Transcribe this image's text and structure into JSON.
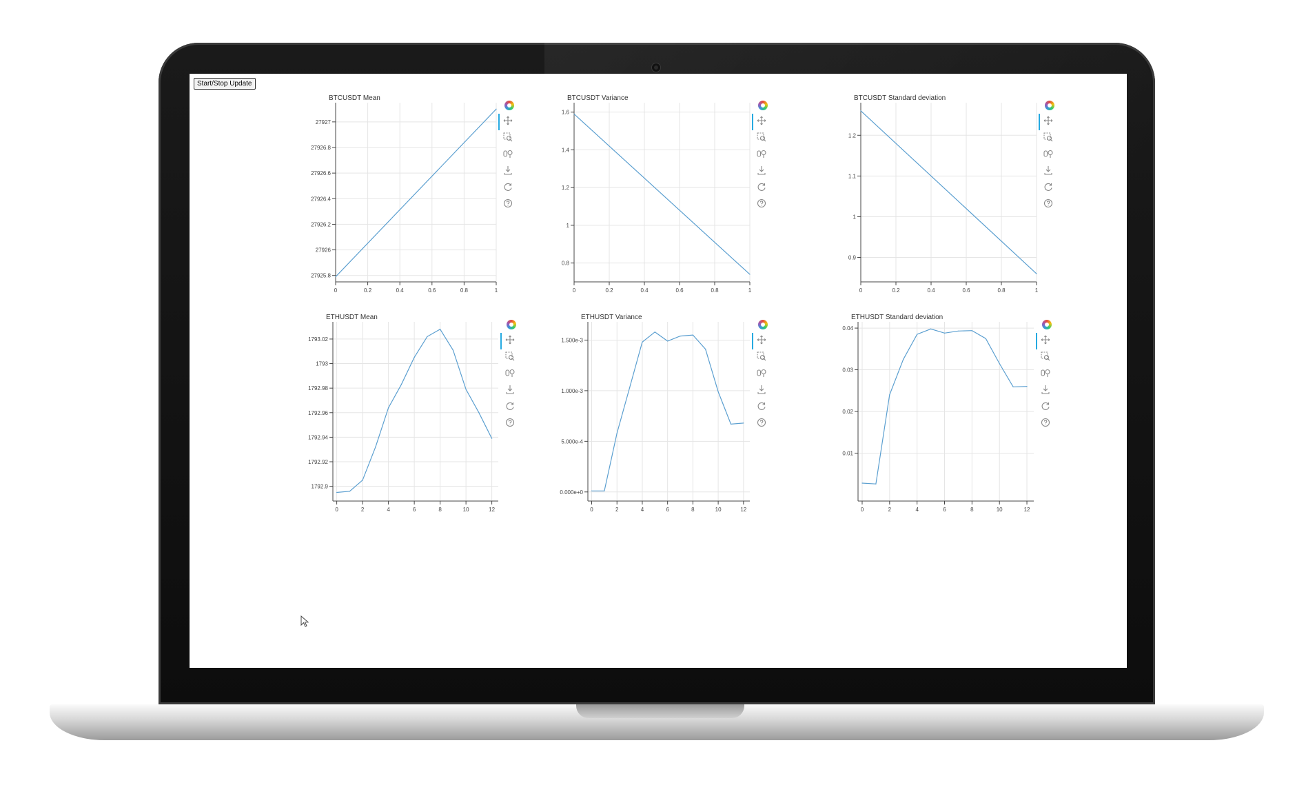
{
  "app": {
    "toggle_button": "Start/Stop Update"
  },
  "toolbar_icons": [
    "bokeh-logo-icon",
    "pan-icon",
    "box-zoom-icon",
    "wheel-zoom-icon",
    "save-icon",
    "reset-icon",
    "help-icon"
  ],
  "colors": {
    "line": "#5b9fd0",
    "grid": "#e5e5e5",
    "accent": "#26aae1"
  },
  "chart_data": [
    {
      "type": "line",
      "title": "BTCUSDT Mean",
      "x": [
        0,
        1
      ],
      "y": [
        27925.79,
        27927.1
      ],
      "xlim": [
        0,
        1
      ],
      "ylim": [
        27925.75,
        27927.15
      ],
      "xticks": [
        "0",
        "0.2",
        "0.4",
        "0.6",
        "0.8",
        "1"
      ],
      "xtick_values": [
        0,
        0.2,
        0.4,
        0.6,
        0.8,
        1
      ],
      "yticks": [
        "27925.8",
        "27926",
        "27926.2",
        "27926.4",
        "27926.6",
        "27926.8",
        "27927"
      ],
      "ytick_values": [
        27925.8,
        27926.0,
        27926.2,
        27926.4,
        27926.6,
        27926.8,
        27927.0
      ]
    },
    {
      "type": "line",
      "title": "BTCUSDT Variance",
      "x": [
        0,
        1
      ],
      "y": [
        1.59,
        0.74
      ],
      "xlim": [
        0,
        1
      ],
      "ylim": [
        0.7,
        1.65
      ],
      "xticks": [
        "0",
        "0.2",
        "0.4",
        "0.6",
        "0.8",
        "1"
      ],
      "xtick_values": [
        0,
        0.2,
        0.4,
        0.6,
        0.8,
        1
      ],
      "yticks": [
        "0.8",
        "1",
        "1.2",
        "1.4",
        "1.6"
      ],
      "ytick_values": [
        0.8,
        1.0,
        1.2,
        1.4,
        1.6
      ]
    },
    {
      "type": "line",
      "title": "BTCUSDT Standard deviation",
      "x": [
        0,
        1
      ],
      "y": [
        1.26,
        0.86
      ],
      "xlim": [
        0,
        1
      ],
      "ylim": [
        0.84,
        1.28
      ],
      "xticks": [
        "0",
        "0.2",
        "0.4",
        "0.6",
        "0.8",
        "1"
      ],
      "xtick_values": [
        0,
        0.2,
        0.4,
        0.6,
        0.8,
        1
      ],
      "yticks": [
        "0.9",
        "1",
        "1.1",
        "1.2"
      ],
      "ytick_values": [
        0.9,
        1.0,
        1.1,
        1.2
      ]
    },
    {
      "type": "line",
      "title": "ETHUSDT Mean",
      "x": [
        0,
        1,
        2,
        3,
        4,
        5,
        6,
        7,
        8,
        9,
        10,
        11,
        12
      ],
      "y": [
        1792.895,
        1792.896,
        1792.905,
        1792.932,
        1792.964,
        1792.983,
        1793.005,
        1793.022,
        1793.028,
        1793.011,
        1792.979,
        1792.96,
        1792.939
      ],
      "xlim": [
        -0.3,
        12.5
      ],
      "ylim": [
        1792.888,
        1793.034
      ],
      "xticks": [
        "0",
        "2",
        "4",
        "6",
        "8",
        "10",
        "12"
      ],
      "xtick_values": [
        0,
        2,
        4,
        6,
        8,
        10,
        12
      ],
      "yticks": [
        "1792.9",
        "1792.92",
        "1792.94",
        "1792.96",
        "1792.98",
        "1793",
        "1793.02"
      ],
      "ytick_values": [
        1792.9,
        1792.92,
        1792.94,
        1792.96,
        1792.98,
        1793.0,
        1793.02
      ]
    },
    {
      "type": "line",
      "title": "ETHUSDT Variance",
      "x": [
        0,
        1,
        2,
        3,
        4,
        5,
        6,
        7,
        8,
        9,
        10,
        11,
        12
      ],
      "y": [
        1e-05,
        1e-05,
        0.00058,
        0.00103,
        0.00148,
        0.00158,
        0.00149,
        0.00154,
        0.00155,
        0.00141,
        0.00099,
        0.00067,
        0.00068
      ],
      "xlim": [
        -0.3,
        12.5
      ],
      "ylim": [
        -9e-05,
        0.00168
      ],
      "xticks": [
        "0",
        "2",
        "4",
        "6",
        "8",
        "10",
        "12"
      ],
      "xtick_values": [
        0,
        2,
        4,
        6,
        8,
        10,
        12
      ],
      "yticks": [
        "0.000e+0",
        "5.000e-4",
        "1.000e-3",
        "1.500e-3"
      ],
      "ytick_values": [
        0,
        0.0005,
        0.001,
        0.0015
      ]
    },
    {
      "type": "line",
      "title": "ETHUSDT Standard deviation",
      "x": [
        0,
        1,
        2,
        3,
        4,
        5,
        6,
        7,
        8,
        9,
        10,
        11,
        12
      ],
      "y": [
        0.0028,
        0.0026,
        0.024,
        0.0325,
        0.0385,
        0.0398,
        0.0388,
        0.0393,
        0.0394,
        0.0375,
        0.0315,
        0.0259,
        0.026
      ],
      "xlim": [
        -0.3,
        12.5
      ],
      "ylim": [
        -0.0015,
        0.0415
      ],
      "xticks": [
        "0",
        "2",
        "4",
        "6",
        "8",
        "10",
        "12"
      ],
      "xtick_values": [
        0,
        2,
        4,
        6,
        8,
        10,
        12
      ],
      "yticks": [
        "0.01",
        "0.02",
        "0.03",
        "0.04"
      ],
      "ytick_values": [
        0.01,
        0.02,
        0.03,
        0.04
      ]
    }
  ]
}
